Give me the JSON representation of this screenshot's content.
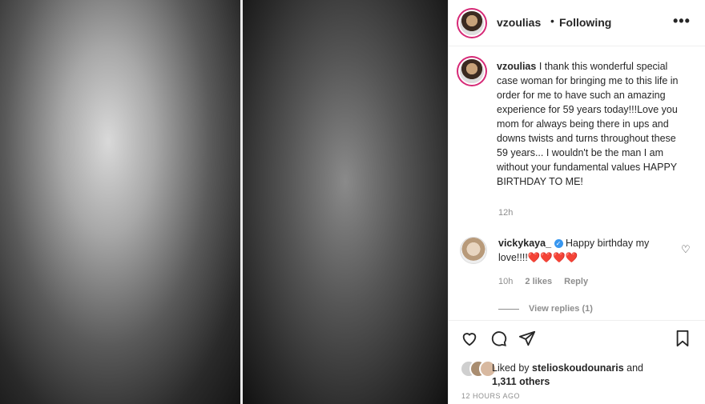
{
  "header": {
    "username": "vzoulias",
    "separator": "•",
    "follow_status": "Following",
    "more": "•••"
  },
  "caption": {
    "username": "vzoulias",
    "text": "I thank this wonderful special case woman for bringing me to this life in order for me to have such an amazing experience for 59 years today!!!Love you mom for always being there in ups and downs twists and turns throughout these 59 years... I wouldn't be the man I am without your fundamental values HAPPY BIRTHDAY TO ME!",
    "time": "12h"
  },
  "comment": {
    "username": "vickykaya_",
    "text": "Happy birthday my love!!!!",
    "hearts": "❤️❤️❤️❤️",
    "time": "10h",
    "likes": "2 likes",
    "reply": "Reply",
    "view_replies": "View replies (1)"
  },
  "likes": {
    "prefix": "Liked by",
    "user": "stelioskoudounaris",
    "and": "and",
    "others": "1,311 others"
  },
  "timestamp": "12 HOURS AGO"
}
